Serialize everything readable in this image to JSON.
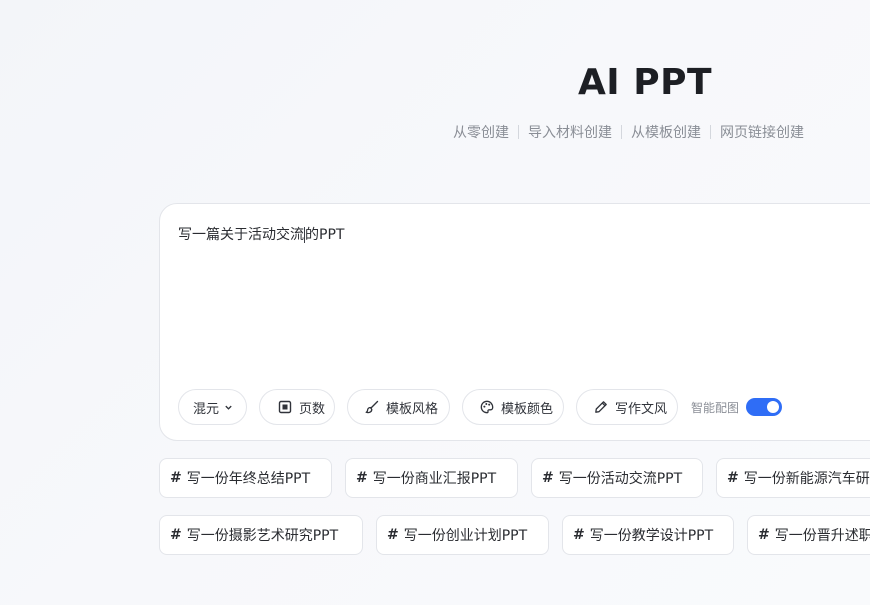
{
  "header": {
    "title": "AI PPT"
  },
  "modes": [
    {
      "label": "从零创建"
    },
    {
      "label": "导入材料创建"
    },
    {
      "label": "从模板创建"
    },
    {
      "label": "网页链接创建"
    }
  ],
  "prompt": {
    "text_before_caret": "写一篇关于活动交流",
    "text_after_caret": "的PPT"
  },
  "toolbar": {
    "model": "混元",
    "pages": "页数",
    "template_style": "模板风格",
    "template_color": "模板颜色",
    "writing_style": "写作文风",
    "smart_image_label": "智能配图",
    "smart_image_on": true
  },
  "suggestions_row1": [
    {
      "label": "写一份年终总结PPT"
    },
    {
      "label": "写一份商业汇报PPT"
    },
    {
      "label": "写一份活动交流PPT"
    },
    {
      "label": "写一份新能源汽车研究PPT"
    }
  ],
  "suggestions_row2": [
    {
      "label": "写一份摄影艺术研究PPT"
    },
    {
      "label": "写一份创业计划PPT"
    },
    {
      "label": "写一份教学设计PPT"
    },
    {
      "label": "写一份晋升述职PPT"
    }
  ],
  "colors": {
    "accent": "#2f6df6",
    "border": "#e3e5ea",
    "muted": "#8a8e96"
  },
  "icons": [
    "chevron-down-icon",
    "grid-icon",
    "brush-icon",
    "palette-icon",
    "pen-icon",
    "hash-icon"
  ]
}
